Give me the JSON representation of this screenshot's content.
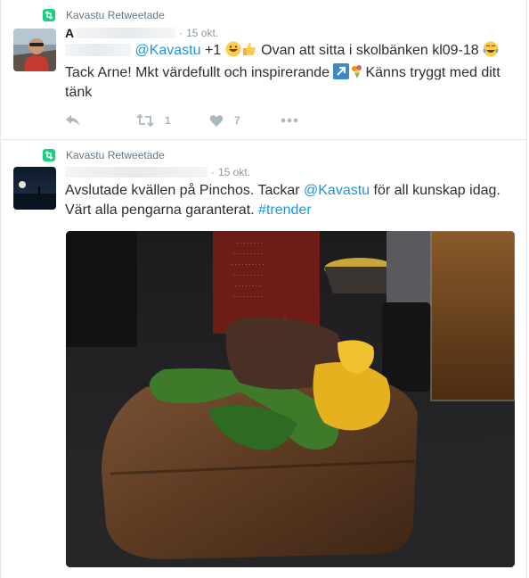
{
  "tweets": [
    {
      "retweet_label": "Kavastu Retweetade",
      "author_initial": "A",
      "time": "15 okt.",
      "line1_rest": "+1",
      "line1_tail": "Ovan att sitta i skolbänken kl09-18",
      "line2_a": "Tack Arne! Mkt värdefullt och inspirerande",
      "line2_b": "Känns tryggt med ditt",
      "line3": "tänk",
      "mention": "@Kavastu",
      "retweets": "1",
      "likes": "7"
    },
    {
      "retweet_label": "Kavastu Retweetade",
      "time": "15 okt.",
      "line1_a": "Avslutade kvällen på Pinchos. Tackar",
      "mention": "@Kavastu",
      "line1_b": "för all kunskap idag.",
      "line2_a": "Värt alla pengarna garanterat.",
      "hashtag": "#trender",
      "menu_sign_word": "APPEN"
    }
  ],
  "icons": [
    "retweeted-badge-icon",
    "reply-icon",
    "retweet-icon",
    "heart-icon",
    "more-icon"
  ],
  "colors": {
    "accent": "#1b95e0",
    "retweet_green": "#19cf86",
    "muted": "#aab8c2"
  }
}
